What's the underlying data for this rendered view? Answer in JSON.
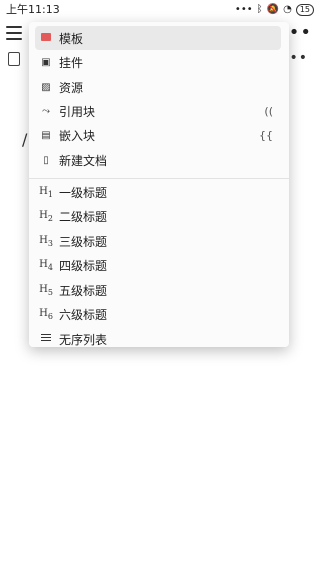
{
  "status_bar": {
    "time": "上午11:13",
    "battery": "15"
  },
  "menu": {
    "items": [
      {
        "label": "模板",
        "icon": "template-icon",
        "hint": ""
      },
      {
        "label": "挂件",
        "icon": "widget-icon",
        "hint": ""
      },
      {
        "label": "资源",
        "icon": "image-icon",
        "hint": ""
      },
      {
        "label": "引用块",
        "icon": "ref-icon",
        "hint": "(("
      },
      {
        "label": "嵌入块",
        "icon": "embed-icon",
        "hint": "{{"
      },
      {
        "label": "新建文档",
        "icon": "doc-icon",
        "hint": ""
      }
    ],
    "headings": [
      {
        "label": "一级标题",
        "n": "1"
      },
      {
        "label": "二级标题",
        "n": "2"
      },
      {
        "label": "三级标题",
        "n": "3"
      },
      {
        "label": "四级标题",
        "n": "4"
      },
      {
        "label": "五级标题",
        "n": "5"
      },
      {
        "label": "六级标题",
        "n": "6"
      }
    ],
    "list": {
      "label": "无序列表"
    }
  },
  "editor": {
    "slash": "/"
  }
}
